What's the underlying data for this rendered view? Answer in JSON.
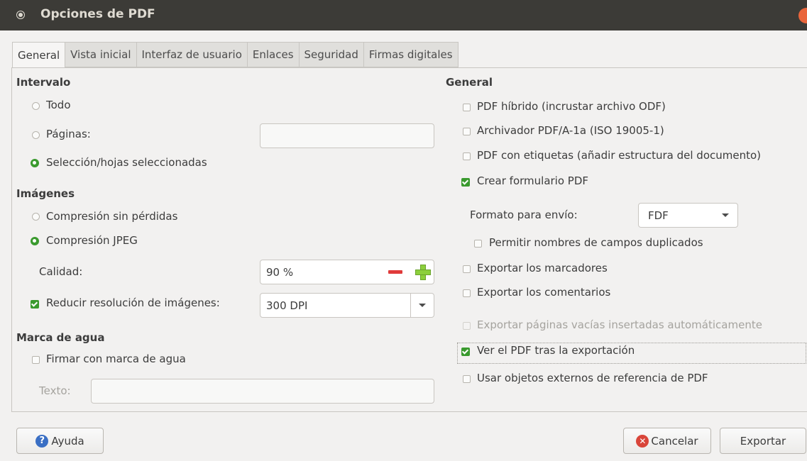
{
  "window": {
    "title": "Opciones de PDF"
  },
  "tabs": [
    {
      "label": "General",
      "active": true
    },
    {
      "label": "Vista inicial",
      "active": false
    },
    {
      "label": "Interfaz de usuario",
      "active": false
    },
    {
      "label": "Enlaces",
      "active": false
    },
    {
      "label": "Seguridad",
      "active": false
    },
    {
      "label": "Firmas digitales",
      "active": false
    }
  ],
  "left": {
    "intervalo": {
      "heading": "Intervalo",
      "todo": "Todo",
      "paginas": "Páginas:",
      "paginas_value": "",
      "seleccion": "Selección/hojas seleccionadas",
      "selected": "seleccion"
    },
    "imagenes": {
      "heading": "Imágenes",
      "sin_perdidas": "Compresión sin pérdidas",
      "jpeg": "Compresión JPEG",
      "selected": "jpeg",
      "calidad_label": "Calidad:",
      "calidad_value": "90 %",
      "reducir_label": "Reducir resolución de imágenes:",
      "reducir_checked": true,
      "dpi_value": "300 DPI"
    },
    "marca": {
      "heading": "Marca de agua",
      "firmar": "Firmar con marca de agua",
      "firmar_checked": false,
      "texto_label": "Texto:",
      "texto_value": ""
    }
  },
  "right": {
    "heading": "General",
    "options": [
      {
        "label": "PDF híbrido (incrustar archivo ODF)",
        "checked": false,
        "disabled": false
      },
      {
        "label": "Archivador PDF/A-1a (ISO 19005-1)",
        "checked": false,
        "disabled": false
      },
      {
        "label": "PDF con etiquetas (añadir estructura del documento)",
        "checked": false,
        "disabled": false
      },
      {
        "label": "Crear formulario PDF",
        "checked": true,
        "disabled": false
      }
    ],
    "formato_label": "Formato para envío:",
    "formato_value": "FDF",
    "duplicados": {
      "label": "Permitir nombres de campos duplicados",
      "checked": false
    },
    "options2": [
      {
        "label": "Exportar los marcadores",
        "checked": false,
        "disabled": false
      },
      {
        "label": "Exportar los comentarios",
        "checked": false,
        "disabled": false
      },
      {
        "label": "Exportar páginas vacías insertadas automáticamente",
        "checked": false,
        "disabled": true
      },
      {
        "label": "Ver el PDF tras la exportación",
        "checked": true,
        "disabled": false
      },
      {
        "label": "Usar objetos externos de referencia de PDF",
        "checked": false,
        "disabled": false
      }
    ]
  },
  "buttons": {
    "help": "Ayuda",
    "cancel": "Cancelar",
    "export": "Exportar"
  },
  "colors": {
    "titlebar": "#3c3b37",
    "check_green": "#3a9a2e",
    "close_orange": "#e9653b"
  }
}
